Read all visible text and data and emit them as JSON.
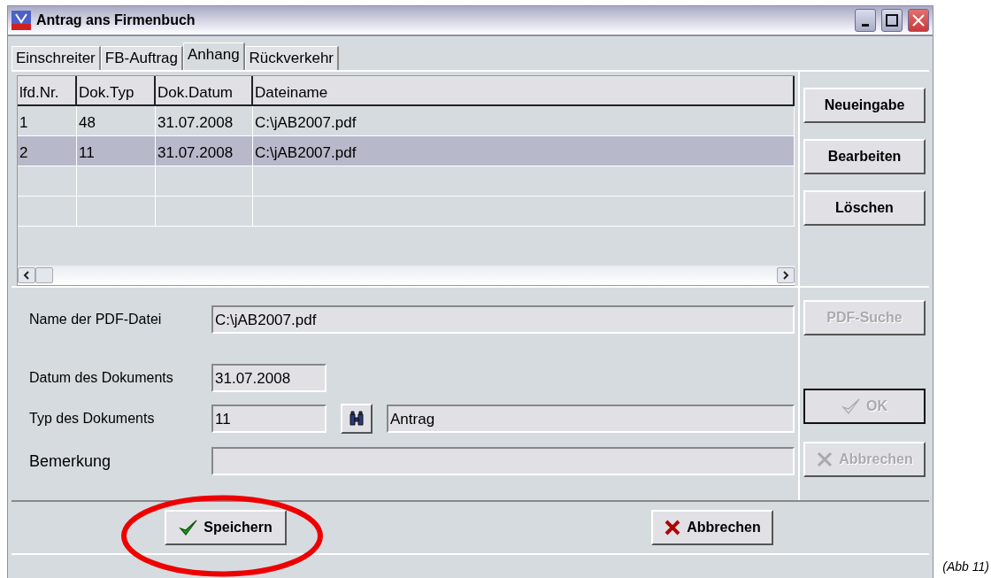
{
  "window": {
    "title": "Antrag ans Firmenbuch"
  },
  "tabs": [
    {
      "label": "Einschreiter",
      "selected": false
    },
    {
      "label": "FB-Auftrag",
      "selected": false
    },
    {
      "label": "Anhang",
      "selected": true
    },
    {
      "label": "Rückverkehr",
      "selected": false
    }
  ],
  "table": {
    "columns": [
      "lfd.Nr.",
      "Dok.Typ",
      "Dok.Datum",
      "Dateiname"
    ],
    "rows": [
      {
        "cells": [
          "1",
          "48",
          "31.07.2008",
          "C:\\jAB2007.pdf"
        ],
        "selected": false
      },
      {
        "cells": [
          "2",
          "11",
          "31.07.2008",
          "C:\\jAB2007.pdf"
        ],
        "selected": true
      }
    ]
  },
  "side_buttons": [
    {
      "label": "Neueingabe",
      "disabled": false
    },
    {
      "label": "Bearbeiten",
      "disabled": false
    },
    {
      "label": "Löschen",
      "disabled": false
    }
  ],
  "form": {
    "pdf_name": {
      "label": "Name der PDF-Datei",
      "value": "C:\\jAB2007.pdf"
    },
    "date": {
      "label": "Datum des Dokuments",
      "value": "31.07.2008"
    },
    "doc_type": {
      "label": "Typ des Dokuments",
      "value": "11",
      "description": "Antrag"
    },
    "remark": {
      "label": "Bemerkung"
    }
  },
  "form_buttons": [
    {
      "label": "PDF-Suche",
      "kind": "plain",
      "disabled": true,
      "focused": false
    },
    {
      "label": "OK",
      "kind": "check",
      "disabled": true,
      "focused": true
    },
    {
      "label": "Abbrechen",
      "kind": "cross",
      "disabled": true,
      "focused": false
    }
  ],
  "footer_buttons": [
    {
      "label": "Speichern",
      "kind": "check",
      "highlighted": true
    },
    {
      "label": "Abbrechen",
      "kind": "cross",
      "highlighted": false
    }
  ],
  "caption": "(Abb 11)"
}
